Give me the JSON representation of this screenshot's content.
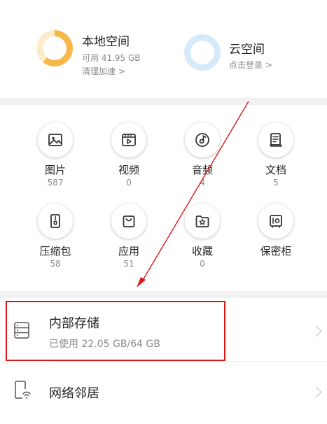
{
  "storage": {
    "local": {
      "title": "本地空间",
      "available": "可用 41.95 GB",
      "cleanup": "清理加速 >",
      "used_fraction": 0.61
    },
    "cloud": {
      "title": "云空间",
      "login": "点击登录 >"
    }
  },
  "categories": [
    {
      "name": "图片",
      "count": "587",
      "icon": "image-icon"
    },
    {
      "name": "视频",
      "count": "0",
      "icon": "video-icon"
    },
    {
      "name": "音频",
      "count": "4",
      "icon": "music-icon"
    },
    {
      "name": "文档",
      "count": "5",
      "icon": "document-icon"
    },
    {
      "name": "压缩包",
      "count": "58",
      "icon": "archive-icon"
    },
    {
      "name": "应用",
      "count": "51",
      "icon": "shopping-bag-icon"
    },
    {
      "name": "收藏",
      "count": "0",
      "icon": "star-folder-icon"
    },
    {
      "name": "保密柜",
      "count": "",
      "icon": "safe-icon"
    }
  ],
  "internal": {
    "title": "内部存储",
    "usage": "已使用 22.05 GB/64 GB",
    "icon": "storage-icon"
  },
  "network": {
    "title": "网络邻居",
    "icon": "network-device-icon"
  },
  "colors": {
    "ring_used": "#f7b84a",
    "ring_track": "#fcecc9",
    "cloud_ring": "#d6eafb",
    "annotation": "#d7191c"
  }
}
